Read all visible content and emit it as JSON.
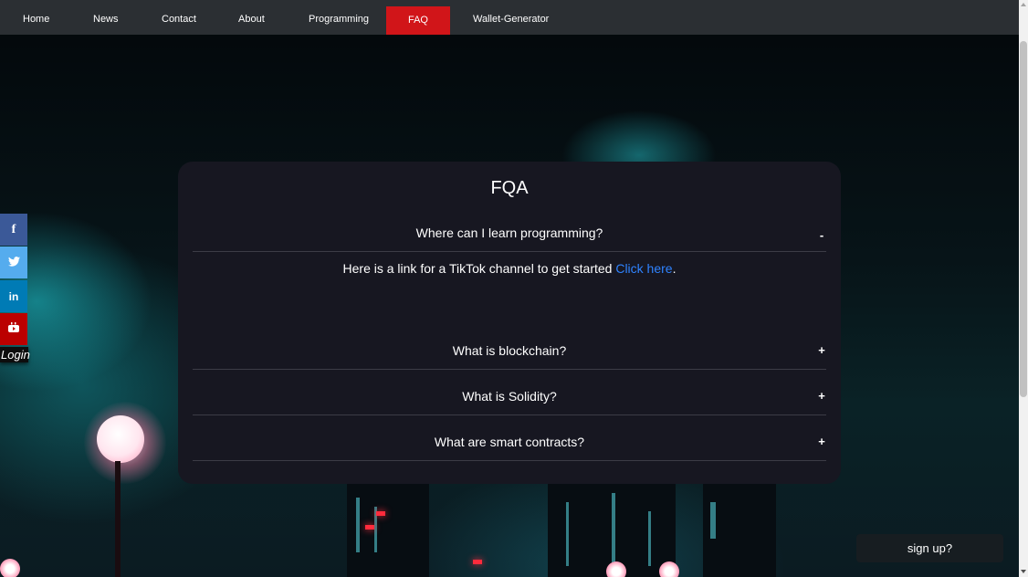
{
  "nav": {
    "items": [
      {
        "label": "Home"
      },
      {
        "label": "News"
      },
      {
        "label": "Contact"
      },
      {
        "label": "About"
      },
      {
        "label": "Programming"
      },
      {
        "label": "FAQ",
        "active": true
      },
      {
        "label": "Wallet-Generator"
      }
    ]
  },
  "faq": {
    "title": "FQA",
    "items": [
      {
        "question": "Where can I learn programming?",
        "toggle": "-",
        "expanded": true
      },
      {
        "question": "What is blockchain?",
        "toggle": "+",
        "expanded": false
      },
      {
        "question": "What is Solidity?",
        "toggle": "+",
        "expanded": false
      },
      {
        "question": "What are smart contracts?",
        "toggle": "+",
        "expanded": false
      }
    ],
    "answer": {
      "text": "Here is a link for a TikTok channel to get started ",
      "link_text": "Click here",
      "suffix": "."
    }
  },
  "social": {
    "items": [
      {
        "name": "facebook",
        "glyph": "f",
        "color": "#3b5998"
      },
      {
        "name": "twitter",
        "glyph": "t",
        "color": "#55acee"
      },
      {
        "name": "linkedin",
        "glyph": "in",
        "color": "#007bb5"
      },
      {
        "name": "youtube",
        "glyph": "▶",
        "color": "#bb0000"
      }
    ],
    "login_label": "Login"
  },
  "signup": {
    "label": "sign up?"
  },
  "colors": {
    "nav_bg": "#2b2f33",
    "nav_active": "#d11519",
    "panel_bg": "#171721",
    "link": "#2f83ff"
  }
}
